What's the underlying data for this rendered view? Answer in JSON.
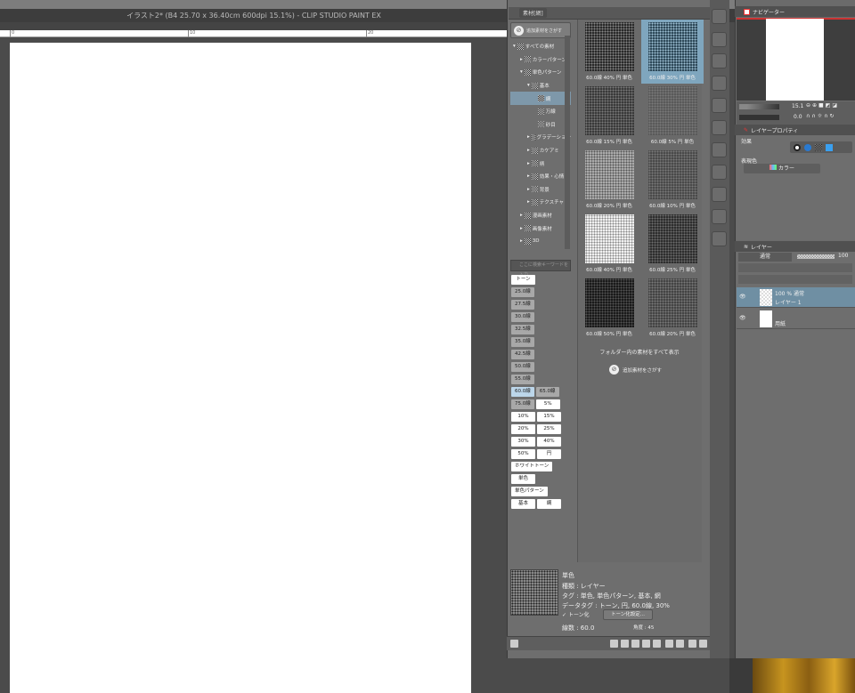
{
  "window": {
    "title": "イラスト2* (B4 25.70 x 36.40cm 600dpi 15.1%)  - CLIP STUDIO PAINT EX"
  },
  "ruler": {
    "labels": [
      "0",
      "10",
      "20"
    ]
  },
  "material_panel": {
    "tab_label": "素材[網]",
    "add_material_button": "追加素材をさがす",
    "tree": [
      {
        "label": "すべての素材",
        "level": 0
      },
      {
        "label": "カラーパターン",
        "level": 1
      },
      {
        "label": "単色パターン",
        "level": 1
      },
      {
        "label": "基本",
        "level": 2
      },
      {
        "label": "網",
        "level": 3,
        "selected": true
      },
      {
        "label": "万線",
        "level": 3
      },
      {
        "label": "砂目",
        "level": 3
      },
      {
        "label": "グラデーション",
        "level": 2
      },
      {
        "label": "カケアミ",
        "level": 2
      },
      {
        "label": "柄",
        "level": 2
      },
      {
        "label": "効果・心情",
        "level": 2
      },
      {
        "label": "背景",
        "level": 2
      },
      {
        "label": "テクスチャ",
        "level": 2
      },
      {
        "label": "漫画素材",
        "level": 1
      },
      {
        "label": "画像素材",
        "level": 1
      },
      {
        "label": "3D",
        "level": 1
      }
    ],
    "search_placeholder": "ここに検索キーワードを入力",
    "tags": [
      {
        "label": "トーン",
        "style": "w"
      },
      {
        "label": "25.0線",
        "style": "g"
      },
      {
        "label": "27.5線",
        "style": "g"
      },
      {
        "label": "30.0線",
        "style": "g"
      },
      {
        "label": "32.5線",
        "style": "g"
      },
      {
        "label": "35.0線",
        "style": "g"
      },
      {
        "label": "42.5線",
        "style": "g"
      },
      {
        "label": "50.0線",
        "style": "g"
      },
      {
        "label": "55.0線",
        "style": "g"
      },
      {
        "label": "60.0線",
        "style": "b"
      },
      {
        "label": "65.0線",
        "style": "g"
      },
      {
        "label": "75.0線",
        "style": "g"
      },
      {
        "label": "5%",
        "style": "w"
      },
      {
        "label": "10%",
        "style": "w"
      },
      {
        "label": "15%",
        "style": "w"
      },
      {
        "label": "20%",
        "style": "w"
      },
      {
        "label": "25%",
        "style": "w"
      },
      {
        "label": "30%",
        "style": "w"
      },
      {
        "label": "40%",
        "style": "w"
      },
      {
        "label": "50%",
        "style": "w"
      },
      {
        "label": "円",
        "style": "w"
      },
      {
        "label": "ホワイトトーン",
        "style": "w"
      },
      {
        "label": "単色",
        "style": "w"
      },
      {
        "label": "単色パターン",
        "style": "w"
      },
      {
        "label": "基本",
        "style": "w"
      },
      {
        "label": "網",
        "style": "w"
      }
    ],
    "items": [
      {
        "label": "60.0線 40% 円 単色",
        "bg": "#2a2a2a",
        "dot": "#888"
      },
      {
        "label": "60.0線 30% 円 単色",
        "bg": "#2f4a5a",
        "dot": "#9fc2d6",
        "selected": true
      },
      {
        "label": "60.0線 15% 円 単色",
        "bg": "#3a3a3a",
        "dot": "#7a7a7a"
      },
      {
        "label": "60.0線 5% 円 単色",
        "bg": "#5a5a5a",
        "dot": "#7a7a7a"
      },
      {
        "label": "60.0線 20% 円 単色",
        "bg": "#aaaaaa",
        "dot": "#555"
      },
      {
        "label": "60.0線 10% 円 単色",
        "bg": "#4a4a4a",
        "dot": "#7a7a7a"
      },
      {
        "label": "60.0線 40% 円 単色",
        "bg": "#f0f0f0",
        "dot": "#888"
      },
      {
        "label": "60.0線 25% 円 単色",
        "bg": "#2e2e2e",
        "dot": "#6e6e6e"
      },
      {
        "label": "60.0線 50% 円 単色",
        "bg": "#1a1a1a",
        "dot": "#555"
      },
      {
        "label": "60.0線 20% 円 単色",
        "bg": "#444",
        "dot": "#7a7a7a"
      }
    ],
    "show_all_label": "フォルダー内の素材をすべて表示",
    "find_more_label": "追加素材をさがす",
    "detail": {
      "name": "単色",
      "type": "種類 : レイヤー",
      "tags": "タグ : 単色, 単色パターン, 基本, 網",
      "data_tags": "データタグ : トーン, 円, 60.0線, 30%",
      "tone_checkbox": "トーン化",
      "tone_checked": true,
      "tone_settings_button": "トーン化設定...",
      "lines": "線数 : 60.0",
      "angle": "角度 : 45"
    }
  },
  "navigator": {
    "tab": "ナビゲーター",
    "zoom": "15.1",
    "rotation": "0.0"
  },
  "layer_property": {
    "tab": "レイヤープロパティ",
    "effect_label": "効果",
    "expression_label": "表現色",
    "expression_value": "カラー"
  },
  "layers": {
    "tab": "レイヤー",
    "blend_mode": "通常",
    "opacity": "100",
    "rows": [
      {
        "info": "100 % 通常",
        "name": "レイヤー 1",
        "selected": true
      },
      {
        "info": "",
        "name": "用紙",
        "selected": false
      }
    ]
  }
}
